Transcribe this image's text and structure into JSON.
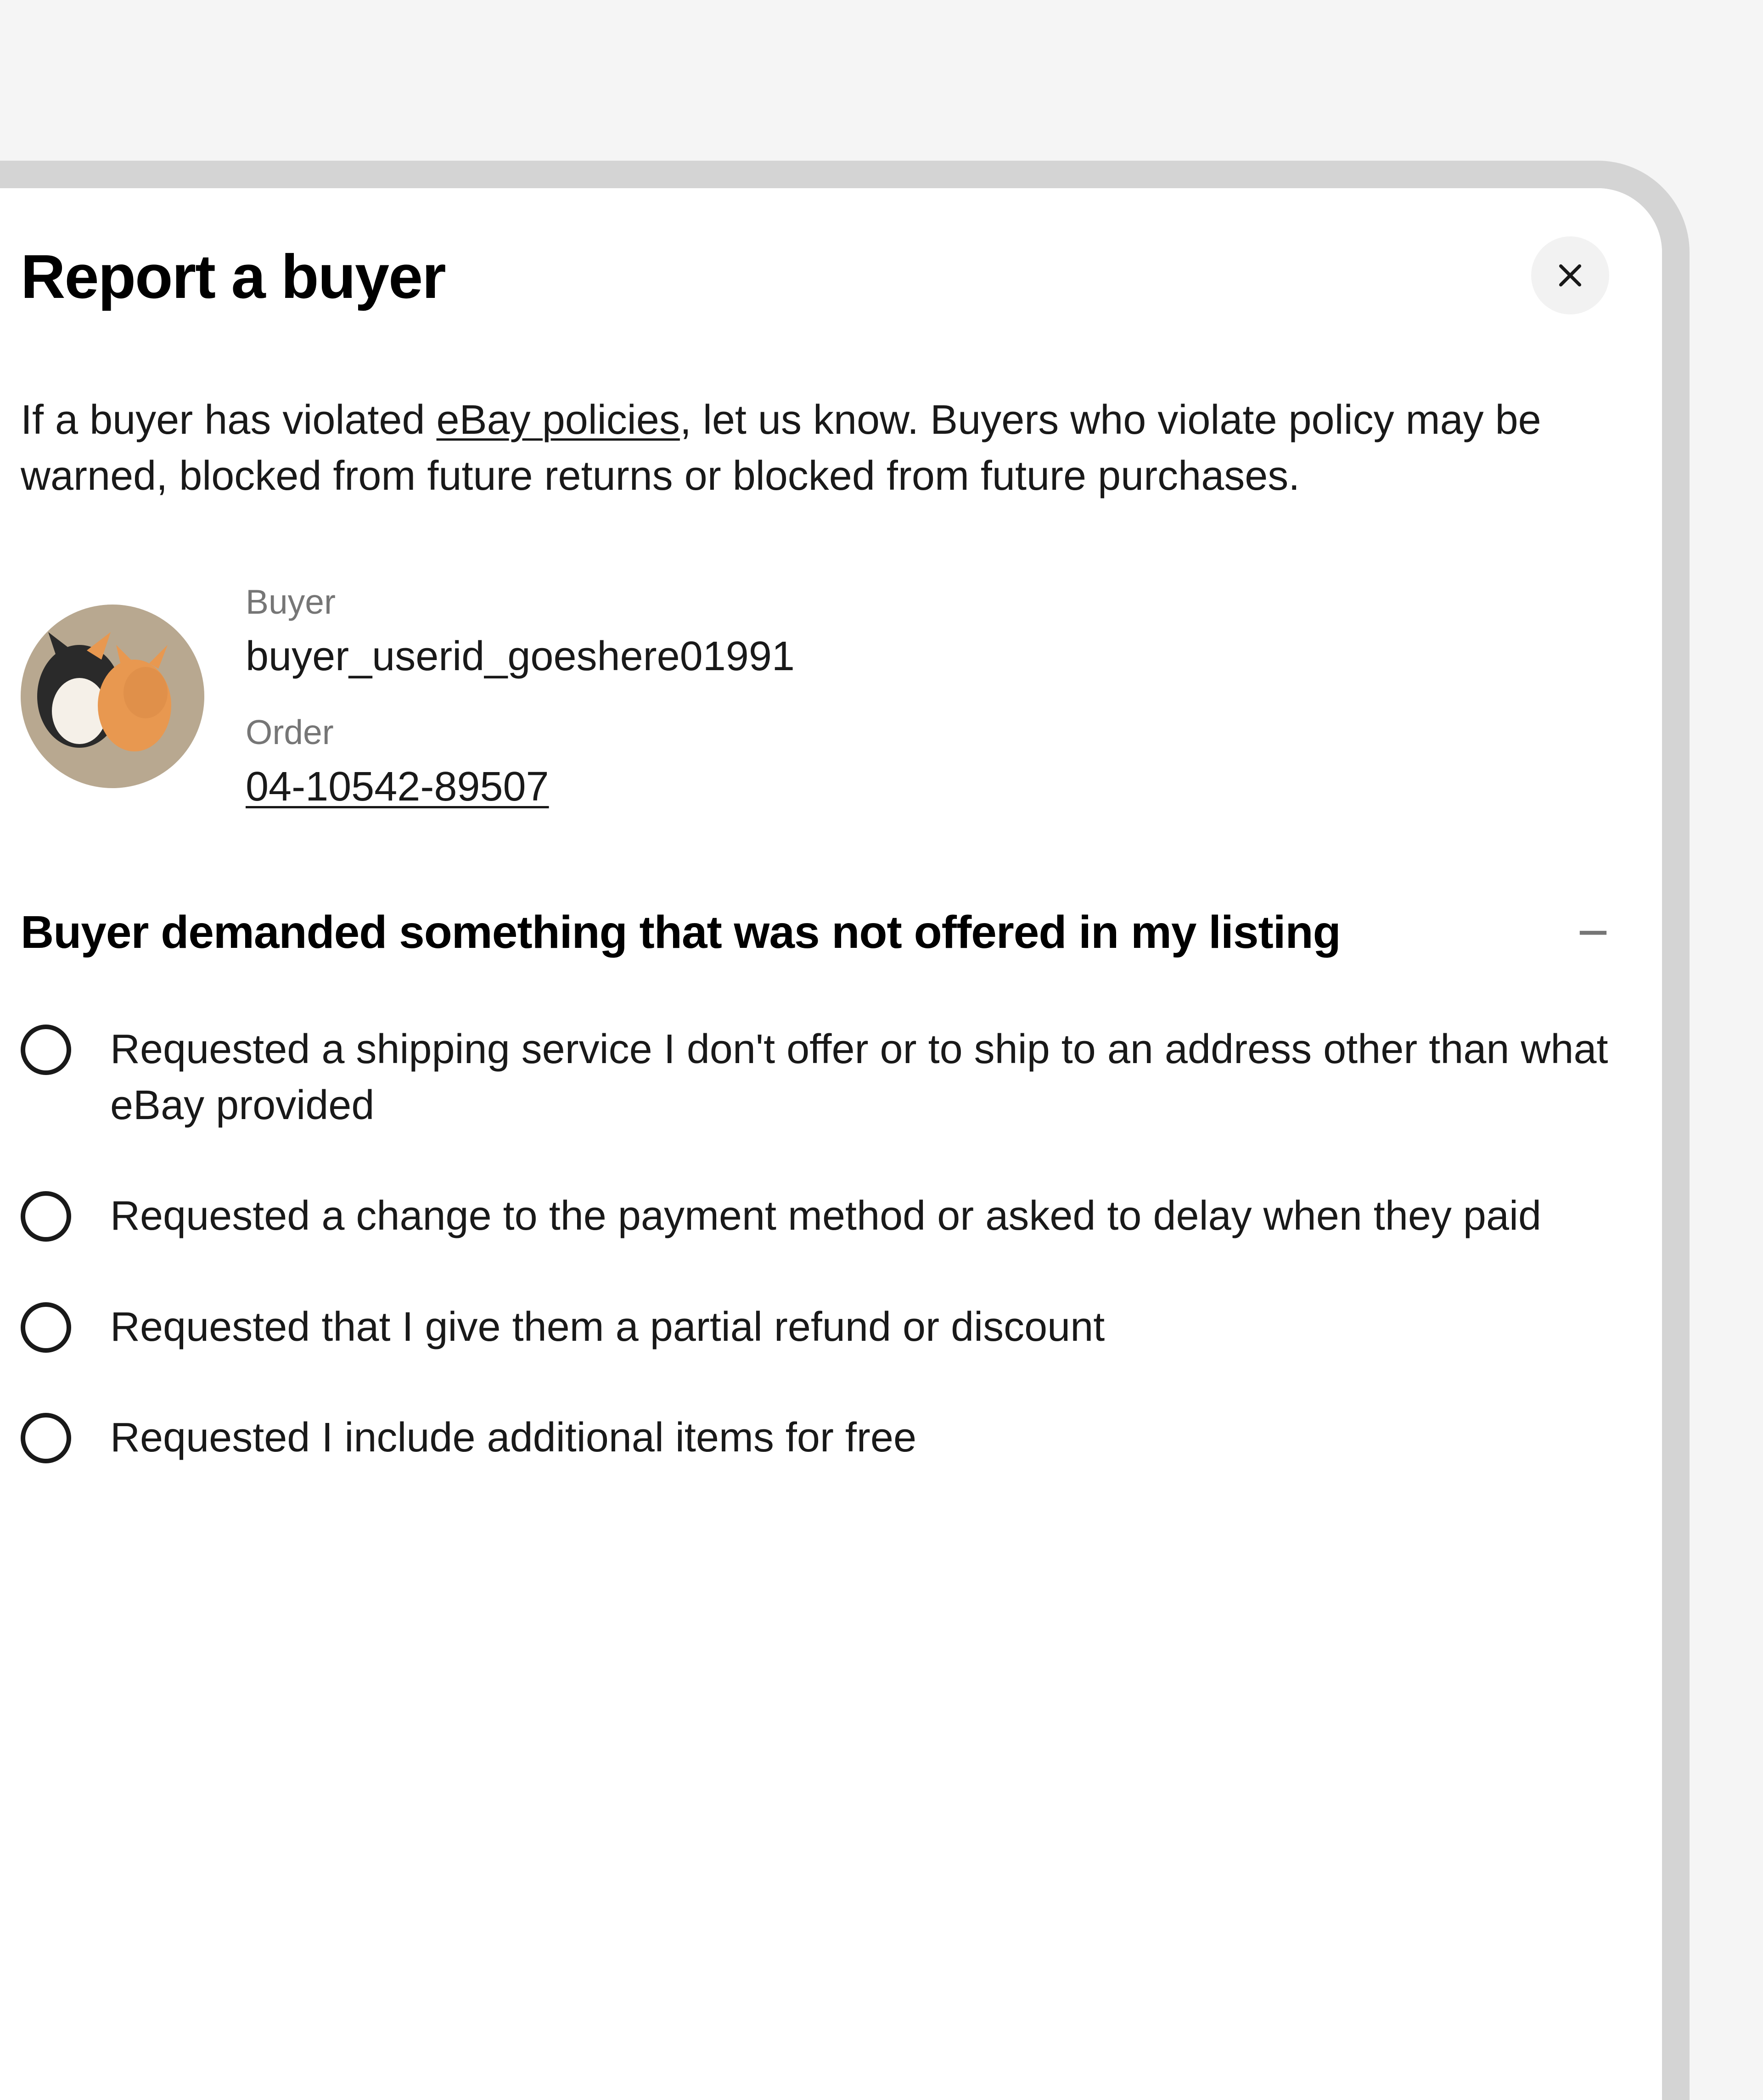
{
  "panel": {
    "title": "Report a buyer",
    "intro_prefix": "If a buyer has violated ",
    "intro_link": "eBay policies",
    "intro_suffix": ", let us know. Buyers who violate policy may be warned, blocked from future returns or blocked from future purchases."
  },
  "buyer": {
    "label": "Buyer",
    "userid": "buyer_userid_goeshere01991",
    "order_label": "Order",
    "order_id": "04-10542-89507"
  },
  "section": {
    "title": "Buyer demanded something that was not offered in my listing",
    "options": [
      "Requested a shipping service I don't offer or to ship to an address other than what eBay provided",
      "Requested a change to the payment method or asked to delay when they paid",
      "Requested that I give them a partial refund or discount",
      "Requested I include additional items for free"
    ]
  }
}
